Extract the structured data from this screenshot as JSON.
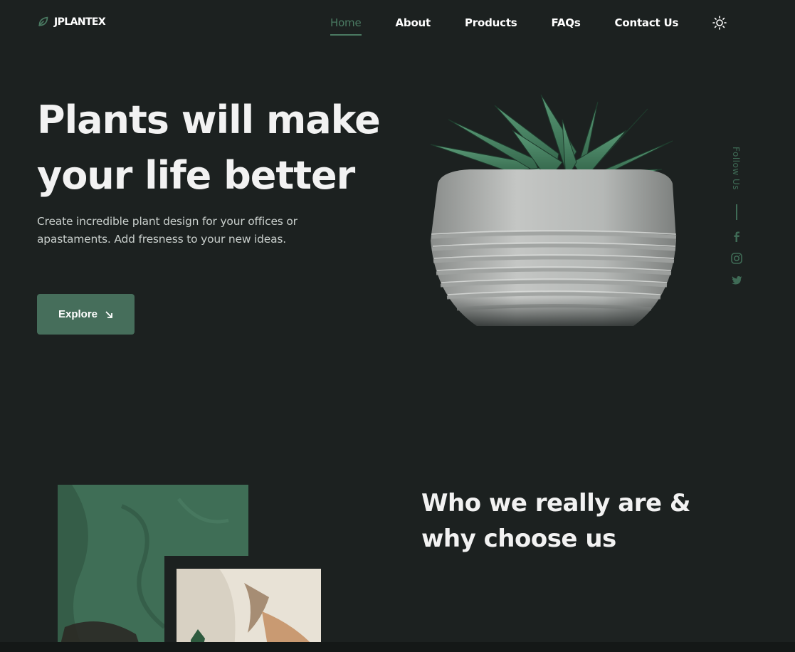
{
  "brand": {
    "name": "JPLANTEX",
    "accent": "#4a7a62"
  },
  "nav": {
    "items": [
      {
        "label": "Home",
        "active": true
      },
      {
        "label": "About"
      },
      {
        "label": "Products"
      },
      {
        "label": "FAQs"
      },
      {
        "label": "Contact Us"
      }
    ],
    "theme_icon": "sun-icon"
  },
  "hero": {
    "title_line1": "Plants will make",
    "title_line2": "your life better",
    "description": "Create incredible plant design for your offices or apastaments. Add fresness to your new ideas.",
    "button_label": "Explore",
    "button_icon": "arrow-down-right-icon"
  },
  "social": {
    "label": "Follow Us",
    "icons": [
      "facebook-icon",
      "instagram-icon",
      "twitter-icon"
    ]
  },
  "about": {
    "title_line1": "Who we really are &",
    "title_line2": "why choose us"
  },
  "colors": {
    "background": "#1c2120",
    "button": "#466e5b",
    "muted_green": "#3f6b56"
  }
}
